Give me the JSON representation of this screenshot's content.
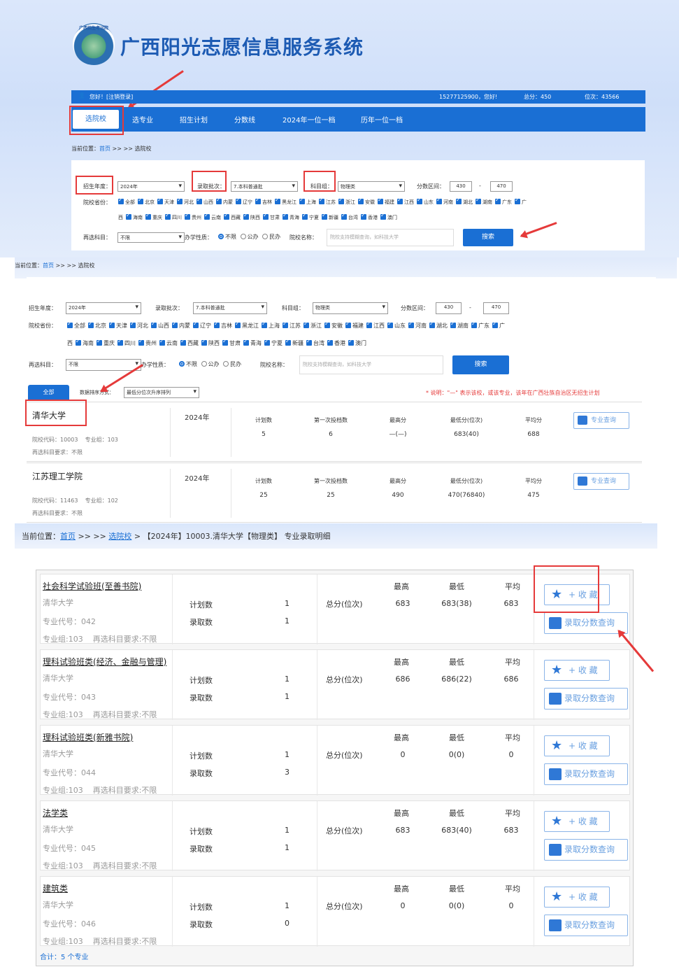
{
  "panel1": {
    "logo_text": "广西招生考试院",
    "system_title": "广西阳光志愿信息服务系统",
    "userbar": {
      "greeting": "您好！[注销登录]",
      "user": "15277125900，您好!",
      "total_score": "总分：450",
      "rank": "位次：43566"
    },
    "nav": [
      "选院校",
      "选专业",
      "招生计划",
      "分数线",
      "2024年一位一档",
      "历年一位一档"
    ],
    "crumb_label": "当前位置：",
    "crumb_home": "首页",
    "crumb_rest": " >> >> 选院校",
    "filters": {
      "year_label": "招生年度：",
      "year_value": "2024年",
      "batch_label": "录取批次：",
      "batch_value": "7.本科普通批",
      "group_label": "科目组：",
      "group_value": "物理类",
      "score_label": "分数区间：",
      "score_min": "430",
      "score_dash": "-",
      "score_max": "470",
      "prov_label": "院校省份：",
      "prov_row1": [
        "全部",
        "北京",
        "天津",
        "河北",
        "山西",
        "内蒙",
        "辽宁",
        "吉林",
        "黑龙江",
        "上海",
        "江苏",
        "浙江",
        "安徽",
        "福建",
        "江西",
        "山东",
        "河南",
        "湖北",
        "湖南",
        "广东",
        "广"
      ],
      "prov_row2": [
        "西",
        "海南",
        "重庆",
        "四川",
        "贵州",
        "云南",
        "西藏",
        "陕西",
        "甘肃",
        "青海",
        "宁夏",
        "新疆",
        "台湾",
        "香港",
        "澳门"
      ],
      "resel_label": "再选科目：",
      "resel_value": "不限",
      "nature_label": "办学性质：",
      "nature_opts": [
        "不限",
        "公办",
        "民办"
      ],
      "name_label": "院校名称：",
      "name_placeholder": "院校支持模糊查询，如科技大学",
      "search_btn": "搜索"
    }
  },
  "panel2": {
    "crumb_label": "当前位置：",
    "crumb_home": "首页",
    "crumb_rest": " >> >> 选院校",
    "tab_all": "全部",
    "sort_label": "数据排序方式：",
    "sort_value": "最低分位次升序排列",
    "note": "* 说明：\"—\" 表示该校，或该专业，该年在广西壮族自治区无招生计划",
    "stat_heads": [
      "计划数",
      "第一次投档数",
      "最高分",
      "最低分(位次)",
      "平均分"
    ],
    "major_btn": "专业查询",
    "universities": [
      {
        "name": "清华大学",
        "code": "院校代码：10003",
        "group": "专业组：103",
        "resel": "再选科目要求：不限",
        "year": "2024年",
        "values": [
          "5",
          "6",
          "—(—)",
          "683(40)",
          "688"
        ]
      },
      {
        "name": "江苏理工学院",
        "code": "院校代码：11463",
        "group": "专业组：102",
        "resel": "再选科目要求：不限",
        "year": "2024年",
        "values": [
          "25",
          "25",
          "490",
          "470(76840)",
          "475"
        ]
      }
    ]
  },
  "panel3": {
    "crumb_label": "当前位置：",
    "crumb_home": "首页",
    "crumb_sep": " >> >> ",
    "crumb_school": "选院校",
    "crumb_rest": " > 【2024年】10003.清华大学【物理类】 专业录取明细",
    "heads": {
      "max": "最高",
      "min": "最低",
      "avg": "平均"
    },
    "plan_label": "计划数",
    "admit_label": "录取数",
    "score_label": "总分(位次)",
    "fav_btn": "+ 收 藏",
    "query_btn": "录取分数查询",
    "majors": [
      {
        "name": "社会科学试验班(至善书院)",
        "school": "清华大学",
        "code": "专业代号：042",
        "group": "专业组:103",
        "resel": "再选科目要求:不限",
        "plan": "1",
        "admit": "1",
        "max": "683",
        "min": "683(38)",
        "avg": "683"
      },
      {
        "name": "理科试验班类(经济、金融与管理)",
        "school": "清华大学",
        "code": "专业代号：043",
        "group": "专业组:103",
        "resel": "再选科目要求:不限",
        "plan": "1",
        "admit": "1",
        "max": "686",
        "min": "686(22)",
        "avg": "686"
      },
      {
        "name": "理科试验班类(新雅书院)",
        "school": "清华大学",
        "code": "专业代号：044",
        "group": "专业组:103",
        "resel": "再选科目要求:不限",
        "plan": "1",
        "admit": "3",
        "max": "0",
        "min": "0(0)",
        "avg": "0"
      },
      {
        "name": "法学类",
        "school": "清华大学",
        "code": "专业代号：045",
        "group": "专业组:103",
        "resel": "再选科目要求:不限",
        "plan": "1",
        "admit": "1",
        "max": "683",
        "min": "683(40)",
        "avg": "683"
      },
      {
        "name": "建筑类",
        "school": "清华大学",
        "code": "专业代号：046",
        "group": "专业组:103",
        "resel": "再选科目要求:不限",
        "plan": "1",
        "admit": "0",
        "max": "0",
        "min": "0(0)",
        "avg": "0"
      }
    ],
    "total": "合计：5 个专业"
  }
}
